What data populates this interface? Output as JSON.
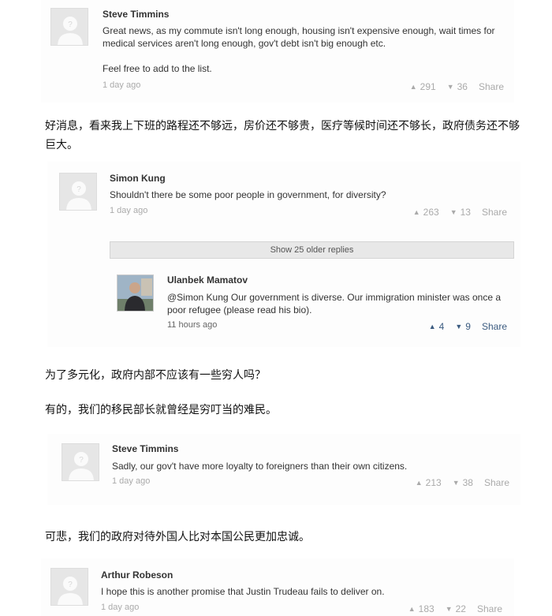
{
  "comments": [
    {
      "author": "Steve Timmins",
      "paragraphs": [
        "Great news, as my commute isn't long enough, housing isn't expensive enough, wait times for medical services aren't long enough, gov't debt isn't big enough etc.",
        "Feel free to add to the list."
      ],
      "time": "1 day ago",
      "up": "291",
      "down": "36",
      "share": "Share"
    },
    {
      "author": "Simon Kung",
      "text": "Shouldn't there be some poor people in government, for diversity?",
      "time": "1 day ago",
      "up": "263",
      "down": "13",
      "share": "Share"
    },
    {
      "author": "Ulanbek Mamatov",
      "text": "@Simon Kung Our government is diverse. Our immigration minister was once a poor refugee (please read his bio).",
      "time": "11 hours ago",
      "up": "4",
      "down": "9",
      "share": "Share"
    },
    {
      "author": "Steve Timmins",
      "text": "Sadly, our gov't have more loyalty to foreigners than their own citizens.",
      "time": "1 day ago",
      "up": "213",
      "down": "38",
      "share": "Share"
    },
    {
      "author": "Arthur Robeson",
      "text": "I hope this is another promise that Justin Trudeau fails to deliver on.",
      "time": "1 day ago",
      "up": "183",
      "down": "22",
      "share": "Share"
    }
  ],
  "show_older": "Show 25 older replies",
  "translations": [
    "好消息，看来我上下班的路程还不够远，房价还不够贵，医疗等候时间还不够长，政府债务还不够巨大。",
    "为了多元化，政府内部不应该有一些穷人吗？",
    "有的，我们的移民部长就曾经是穷叮当的难民。",
    "可悲，我们的政府对待外国人比对本国公民更加忠诚。"
  ],
  "icons": {
    "upvote": "▲",
    "downvote": "▼"
  },
  "colors": {
    "accent": "#3b5b80",
    "muted": "#aaaaaa"
  }
}
